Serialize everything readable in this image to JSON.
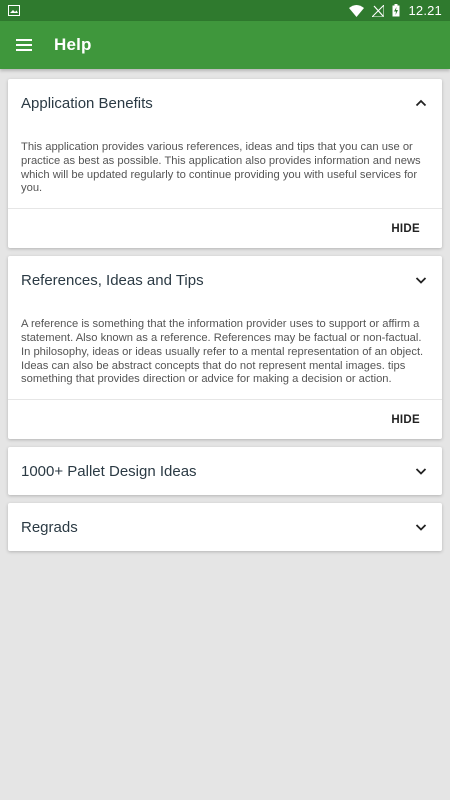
{
  "status_bar": {
    "time": "12.21"
  },
  "app_bar": {
    "title": "Help"
  },
  "sections": [
    {
      "title": "Application Benefits",
      "expanded": true,
      "body": "This application provides various references, ideas and tips that you can use or practice as best as possible. This application also provides information and news which will be updated regularly to continue providing you with useful services for you.",
      "action_label": "HIDE"
    },
    {
      "title": "References, Ideas and Tips",
      "expanded": true,
      "body": "A reference is something that the information provider uses to support or affirm a statement. Also known as a reference. References may be factual or non-factual. In philosophy, ideas or ideas usually refer to a mental representation of an object. Ideas can also be abstract concepts that do not represent mental images. tips something that provides direction or advice for making a decision or action.",
      "action_label": "HIDE"
    },
    {
      "title": "1000+ Pallet Design Ideas",
      "expanded": false
    },
    {
      "title": "Regrads",
      "expanded": false
    }
  ],
  "colors": {
    "status_bar": "#2f7a2e",
    "app_bar": "#3f973c",
    "background": "#e5e5e5"
  }
}
